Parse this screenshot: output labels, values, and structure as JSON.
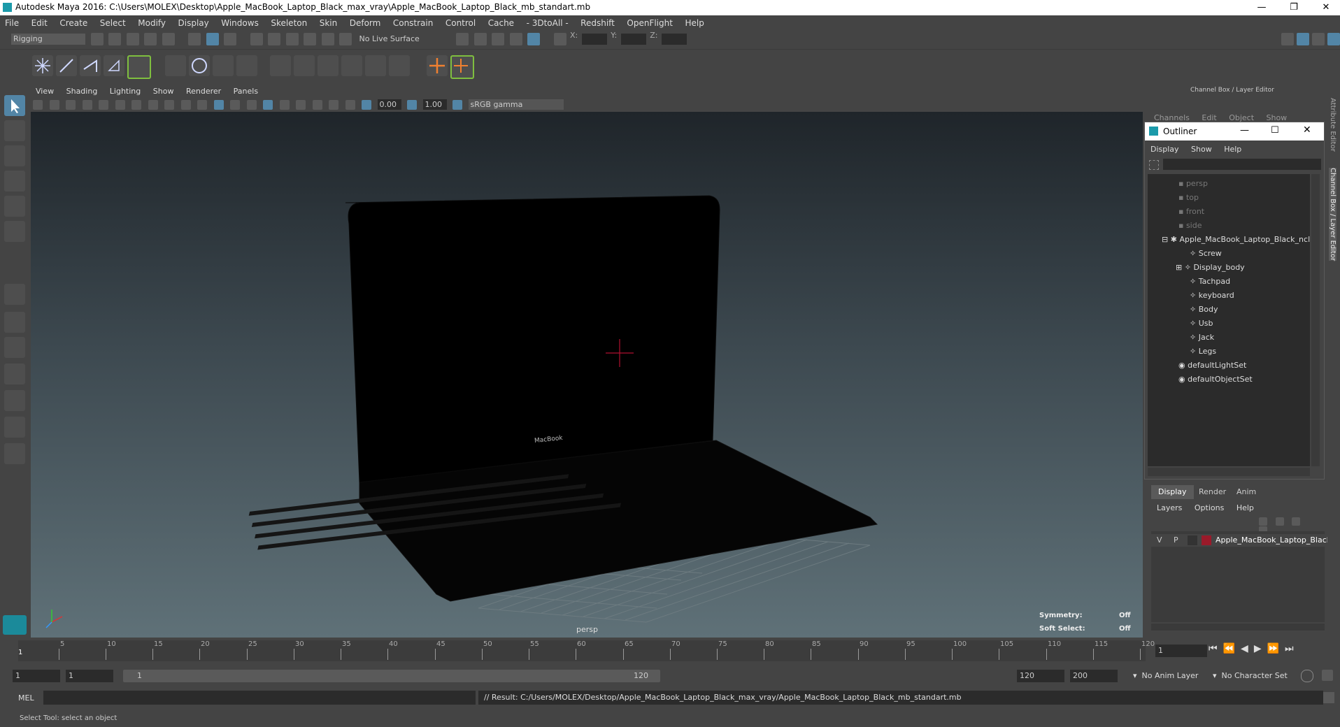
{
  "window": {
    "title": "Autodesk Maya 2016: C:\\Users\\MOLEX\\Desktop\\Apple_MacBook_Laptop_Black_max_vray\\Apple_MacBook_Laptop_Black_mb_standart.mb",
    "minimize": "—",
    "restore": "❐",
    "close": "✕"
  },
  "menubar": [
    "File",
    "Edit",
    "Create",
    "Select",
    "Modify",
    "Display",
    "Windows",
    "Skeleton",
    "Skin",
    "Deform",
    "Constrain",
    "Control",
    "Cache",
    "- 3DtoAll -",
    "Redshift",
    "OpenFlight",
    "Help"
  ],
  "statusline": {
    "mode": "Rigging",
    "live_surface": "No Live Surface",
    "x_label": "X:",
    "y_label": "Y:",
    "z_label": "Z:"
  },
  "viewport": {
    "menu": [
      "View",
      "Shading",
      "Lighting",
      "Show",
      "Renderer",
      "Panels"
    ],
    "exposure": "0.00",
    "gamma": "1.00",
    "colorspace": "sRGB gamma",
    "camera": "persp",
    "symmetry_label": "Symmetry:",
    "symmetry_value": "Off",
    "soft_select_label": "Soft Select:",
    "soft_select_value": "Off",
    "laptop_logo": "MacBook"
  },
  "channelbox": {
    "title": "Channel Box / Layer Editor",
    "menu": [
      "Channels",
      "Edit",
      "Object",
      "Show"
    ]
  },
  "outliner": {
    "title": "Outliner",
    "menu": [
      "Display",
      "Show",
      "Help"
    ],
    "items": [
      {
        "label": "persp",
        "dim": true
      },
      {
        "label": "top",
        "dim": true
      },
      {
        "label": "front",
        "dim": true
      },
      {
        "label": "side",
        "dim": true
      },
      {
        "label": "Apple_MacBook_Laptop_Black_ncl",
        "dim": false
      },
      {
        "label": "Screw",
        "dim": false
      },
      {
        "label": "Display_body",
        "dim": false
      },
      {
        "label": "Tachpad",
        "dim": false
      },
      {
        "label": "keyboard",
        "dim": false
      },
      {
        "label": "Body",
        "dim": false
      },
      {
        "label": "Usb",
        "dim": false
      },
      {
        "label": "Jack",
        "dim": false
      },
      {
        "label": "Legs",
        "dim": false
      },
      {
        "label": "defaultLightSet",
        "dim": false
      },
      {
        "label": "defaultObjectSet",
        "dim": false
      }
    ]
  },
  "layers": {
    "tabs": [
      "Display",
      "Render",
      "Anim"
    ],
    "menu": [
      "Layers",
      "Options",
      "Help"
    ],
    "layer_v": "V",
    "layer_p": "P",
    "layer_name": "Apple_MacBook_Laptop_Black",
    "layer_color": "#9a1a2a"
  },
  "timeline": {
    "ticks": [
      "5",
      "10",
      "15",
      "20",
      "25",
      "30",
      "35",
      "40",
      "45",
      "50",
      "55",
      "60",
      "65",
      "70",
      "75",
      "80",
      "85",
      "90",
      "95",
      "100",
      "105",
      "110",
      "115",
      "120"
    ],
    "current_frame": "1",
    "current_marker": "1"
  },
  "range": {
    "start": "1",
    "start2": "1",
    "slider_start": "1",
    "slider_end": "120",
    "end": "120",
    "end2": "200",
    "anim_layer": "No Anim Layer",
    "char_set": "No Character Set"
  },
  "command": {
    "lang": "MEL",
    "result": "// Result: C:/Users/MOLEX/Desktop/Apple_MacBook_Laptop_Black_max_vray/Apple_MacBook_Laptop_Black_mb_standart.mb"
  },
  "help": {
    "text": "Select Tool: select an object"
  },
  "side_tabs": [
    "Attribute Editor",
    "Channel Box / Layer Editor"
  ]
}
